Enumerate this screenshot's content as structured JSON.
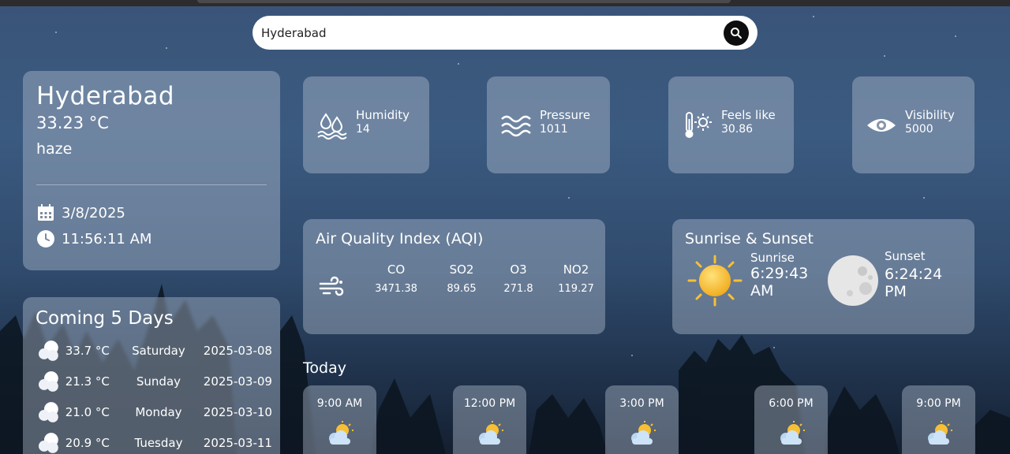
{
  "search": {
    "value": "Hyderabad",
    "placeholder": ""
  },
  "current": {
    "city": "Hyderabad",
    "temperature": "33.23 °C",
    "description": "haze",
    "date": "3/8/2025",
    "time": "11:56:11 AM"
  },
  "stats": [
    {
      "label": "Humidity",
      "value": "14",
      "icon": "humidity-icon"
    },
    {
      "label": "Pressure",
      "value": "1011",
      "icon": "pressure-wave-icon"
    },
    {
      "label": "Feels like",
      "value": "30.86",
      "icon": "thermometer-sun-icon"
    },
    {
      "label": "Visibility",
      "value": "5000",
      "icon": "eye-icon"
    }
  ],
  "aqi": {
    "title": "Air Quality Index (AQI)",
    "icon": "wind-icon",
    "items": [
      {
        "label": "CO",
        "value": "3471.38"
      },
      {
        "label": "SO2",
        "value": "89.65"
      },
      {
        "label": "O3",
        "value": "271.8"
      },
      {
        "label": "NO2",
        "value": "119.27"
      }
    ]
  },
  "sun": {
    "title": "Sunrise & Sunset",
    "sunrise_label": "Sunrise",
    "sunrise_time": "6:29:43",
    "sunrise_period": "AM",
    "sunset_label": "Sunset",
    "sunset_time": "6:24:24",
    "sunset_period": "PM"
  },
  "forecast": {
    "title": "Coming 5 Days",
    "days": [
      {
        "temp": "33.7 °C",
        "day": "Saturday",
        "date": "2025-03-08"
      },
      {
        "temp": "21.3 °C",
        "day": "Sunday",
        "date": "2025-03-09"
      },
      {
        "temp": "21.0 °C",
        "day": "Monday",
        "date": "2025-03-10"
      },
      {
        "temp": "20.9 °C",
        "day": "Tuesday",
        "date": "2025-03-11"
      }
    ]
  },
  "today": {
    "label": "Today",
    "hours": [
      "9:00 AM",
      "12:00 PM",
      "3:00 PM",
      "6:00 PM",
      "9:00 PM"
    ]
  },
  "colors": {
    "card_bg": "#b4c0d2",
    "search_button": "#0d0d0d",
    "sun": "#f7c034",
    "moon": "#e6e6e6"
  }
}
